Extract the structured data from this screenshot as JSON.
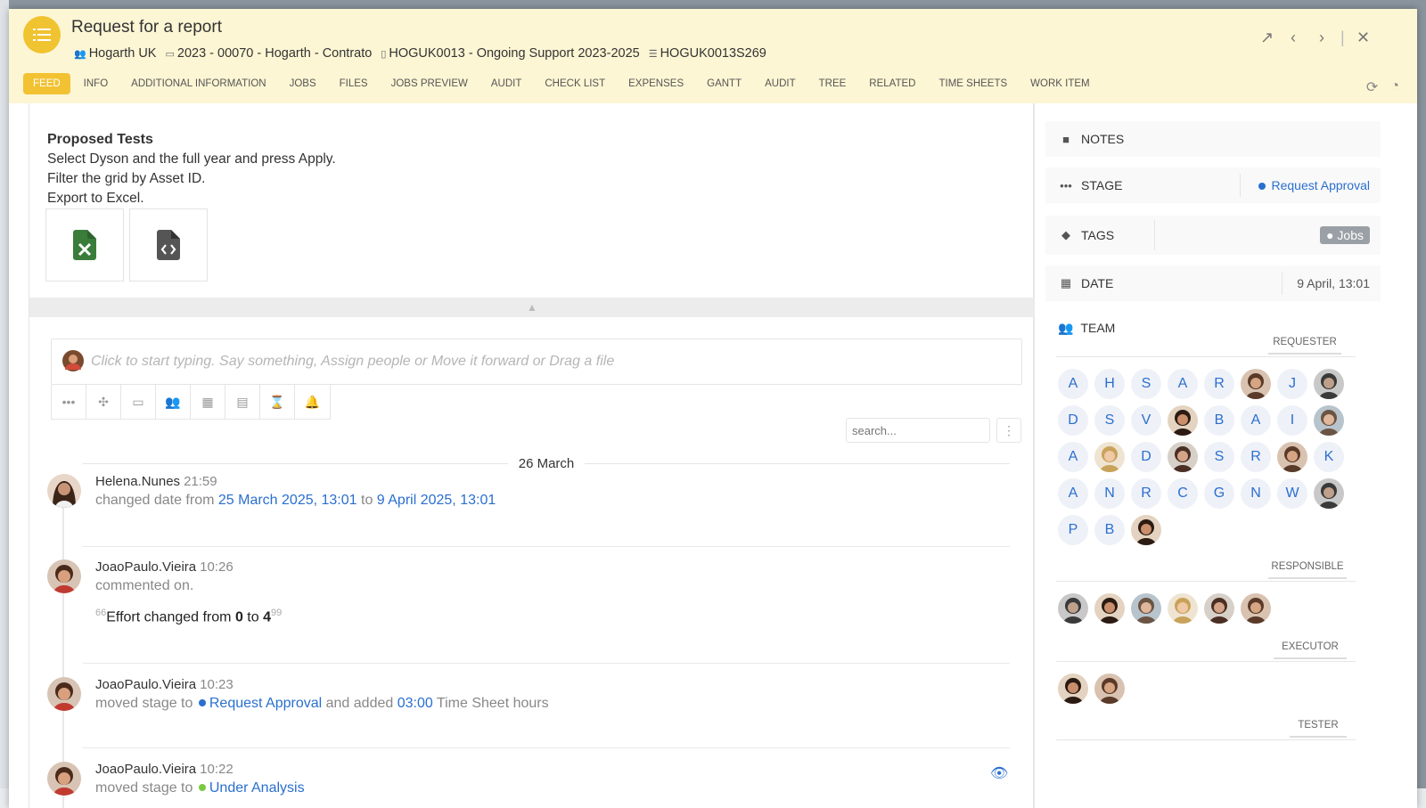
{
  "colors": {
    "accent": "#f2c233",
    "link": "#2a6fcf",
    "header_bg": "#fdf6d4"
  },
  "header": {
    "title": "Request for a report",
    "crumbs": [
      "Hogarth UK",
      "2023 - 00070 - Hogarth - Contrato",
      "HOGUK0013 - Ongoing Support 2023-2025",
      "HOGUK0013S269"
    ],
    "controls": [
      "open-external-icon",
      "previous-icon",
      "next-icon",
      "close-icon"
    ]
  },
  "tabs": [
    "FEED",
    "INFO",
    "ADDITIONAL INFORMATION",
    "JOBS",
    "FILES",
    "JOBS PREVIEW",
    "AUDIT",
    "CHECK LIST",
    "EXPENSES",
    "GANTT",
    "AUDIT",
    "TREE",
    "RELATED",
    "TIME SHEETS",
    "WORK ITEM"
  ],
  "description": {
    "heading": "Proposed Tests",
    "lines": [
      "Select Dyson and the full year and press Apply.",
      "Filter the grid by Asset ID.",
      "Export to Excel."
    ]
  },
  "composer": {
    "placeholder": "Click to start typing. Say something, Assign people or Move it forward or Drag a file"
  },
  "feed_search": {
    "placeholder": "search..."
  },
  "feed": {
    "day": "26 March",
    "entries": [
      {
        "user": "Helena.Nunes",
        "time": "21:59",
        "pre": "changed date from",
        "from": "25 March 2025, 13:01",
        "mid": "to",
        "to": "9 April 2025, 13:01"
      },
      {
        "user": "JoaoPaulo.Vieira",
        "time": "10:26",
        "action": "commented on.",
        "note_pre": "Effort changed from",
        "note_from": "0",
        "note_mid": "to",
        "note_to": "4",
        "sup_left": "66",
        "sup_right": "99"
      },
      {
        "user": "JoaoPaulo.Vieira",
        "time": "10:23",
        "pre": "moved stage to",
        "stage": "Request Approval",
        "mid": "and added",
        "hours": "03:00",
        "post": "Time Sheet hours"
      },
      {
        "user": "JoaoPaulo.Vieira",
        "time": "10:22",
        "pre": "moved stage to",
        "stage": "Under Analysis"
      }
    ]
  },
  "sidebar": {
    "notes": "NOTES",
    "stage_label": "STAGE",
    "stage_value": "Request Approval",
    "tags_label": "TAGS",
    "tag": "Jobs",
    "date_label": "DATE",
    "date_value": "9 April, 13:01",
    "team_label": "TEAM",
    "roles": [
      "REQUESTER",
      "RESPONSIBLE",
      "EXECUTOR",
      "TESTER"
    ],
    "requester_chips": [
      "A",
      "H",
      "S",
      "A",
      "R",
      "",
      "J",
      "",
      "D",
      "S",
      "V",
      "",
      "B",
      "A",
      "I",
      "",
      "A",
      "",
      "D",
      "",
      "S",
      "R",
      "",
      "K",
      "A",
      "N",
      "R",
      "C",
      "G",
      "N",
      "W",
      "",
      "P",
      "B",
      ""
    ]
  }
}
